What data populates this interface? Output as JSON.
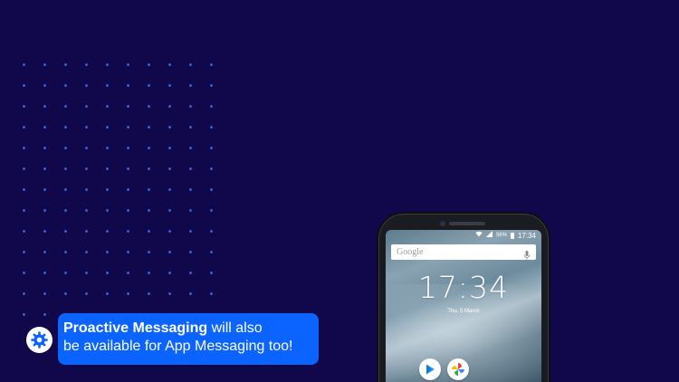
{
  "colors": {
    "background": "#10084a",
    "dot_pattern": "#4778ff",
    "bubble": "#0b64ff",
    "icon_badge": "#ffffff",
    "icon_gear": "#0b64ff"
  },
  "phone": {
    "status_bar": {
      "wifi_icon": "wifi-icon",
      "signal_icon": "signal-icon",
      "battery_level": "56%",
      "time": "17:34"
    },
    "search": {
      "logo_text": "Google",
      "mic_icon": "mic-icon"
    },
    "lock_screen": {
      "clock": "17:34",
      "date": "Thu, 5 March"
    },
    "apps": [
      {
        "name": "Play Store",
        "icon": "play-store-icon"
      },
      {
        "name": "Photos",
        "icon": "pinwheel-icon"
      }
    ]
  },
  "callout": {
    "icon": "gear-icon",
    "bold_text": "Proactive Messaging",
    "text_line1": " will also",
    "text_line2": "be available for App Messaging too!"
  }
}
